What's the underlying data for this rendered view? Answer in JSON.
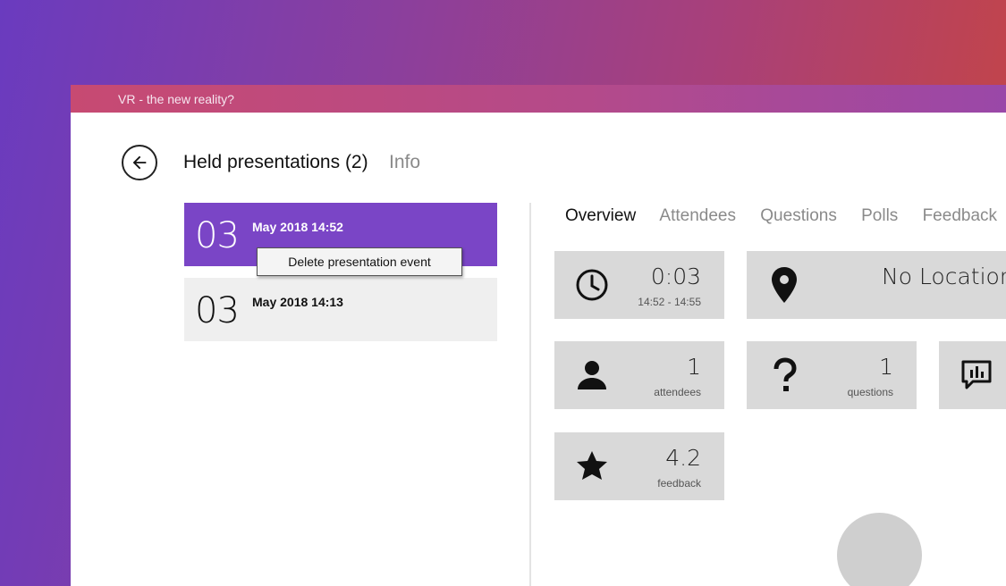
{
  "window": {
    "title": "VR - the new reality?"
  },
  "header": {
    "title": "Held presentations (2)",
    "info_tab": "Info"
  },
  "presentations": [
    {
      "day": "03",
      "datetime": "May 2018 14:52"
    },
    {
      "day": "03",
      "datetime": "May 2018 14:13"
    }
  ],
  "context_menu": {
    "item": "Delete presentation event"
  },
  "tabs": [
    "Overview",
    "Attendees",
    "Questions",
    "Polls",
    "Feedback"
  ],
  "tiles": {
    "duration": {
      "value": "0:03",
      "sub": "14:52 - 14:55",
      "icon": "clock-icon"
    },
    "location": {
      "value": "No Location set",
      "icon": "location-pin-icon"
    },
    "attendees": {
      "value": "1",
      "sub": "attendees",
      "icon": "person-icon"
    },
    "questions": {
      "value": "1",
      "sub": "questions",
      "icon": "question-icon"
    },
    "polls": {
      "icon": "poll-chat-icon"
    },
    "feedback": {
      "value": "4.2",
      "sub": "feedback",
      "icon": "star-icon"
    }
  },
  "colors": {
    "accent": "#7a45c6",
    "tile": "#d9d9d9"
  }
}
